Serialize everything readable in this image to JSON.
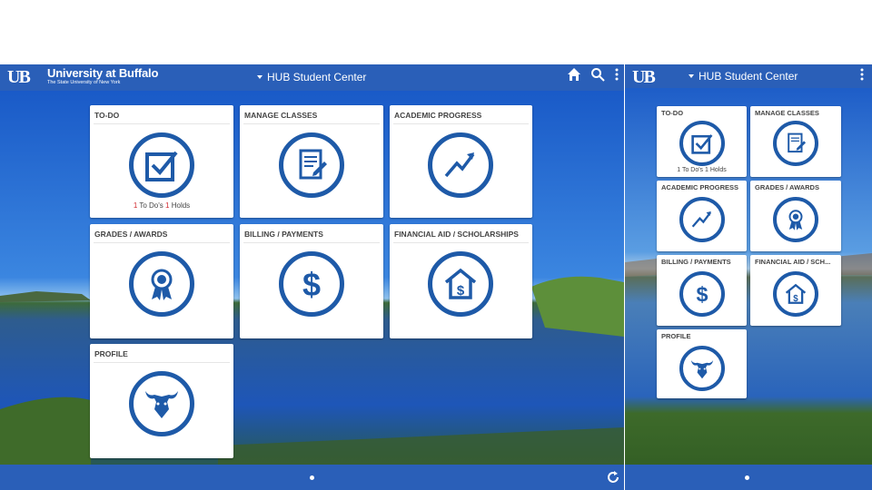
{
  "tablet": {
    "brand": {
      "name": "University at Buffalo",
      "subtitle": "The State University of New York",
      "logo_letters": "UB"
    },
    "title": "HUB Student Center",
    "top_icons": [
      "home-icon",
      "search-icon",
      "more-vert-icon"
    ],
    "tiles": [
      {
        "key": "todo",
        "title": "TO-DO",
        "icon": "checkbox-icon",
        "status": {
          "todo_count": "1",
          "todo_label": "To Do's",
          "holds_count": "1",
          "holds_label": "Holds"
        }
      },
      {
        "key": "manage",
        "title": "MANAGE CLASSES",
        "icon": "document-pencil-icon"
      },
      {
        "key": "progress",
        "title": "ACADEMIC PROGRESS",
        "icon": "trend-arrow-icon"
      },
      {
        "key": "grades",
        "title": "GRADES / AWARDS",
        "icon": "award-ribbon-icon"
      },
      {
        "key": "billing",
        "title": "BILLING / PAYMENTS",
        "icon": "dollar-icon"
      },
      {
        "key": "finaid",
        "title": "FINANCIAL AID / SCHOLARSHIPS",
        "icon": "house-dollar-icon"
      },
      {
        "key": "profile",
        "title": "PROFILE",
        "icon": "bull-icon"
      }
    ],
    "bottom_icons": [
      "page-dot-icon",
      "refresh-icon"
    ]
  },
  "phone": {
    "brand": {
      "logo_letters": "UB"
    },
    "title": "HUB Student Center",
    "top_icons": [
      "more-vert-icon"
    ],
    "tiles": [
      {
        "key": "todo",
        "title": "TO-DO",
        "icon": "checkbox-icon",
        "status": {
          "todo_count": "1",
          "todo_label": "To Do's",
          "holds_count": "1",
          "holds_label": "Holds"
        }
      },
      {
        "key": "manage",
        "title": "MANAGE CLASSES",
        "icon": "document-pencil-icon"
      },
      {
        "key": "progress",
        "title": "ACADEMIC PROGRESS",
        "icon": "trend-arrow-icon"
      },
      {
        "key": "grades",
        "title": "GRADES / AWARDS",
        "icon": "award-ribbon-icon"
      },
      {
        "key": "billing",
        "title": "BILLING / PAYMENTS",
        "icon": "dollar-icon"
      },
      {
        "key": "finaid",
        "title": "FINANCIAL AID / SCH...",
        "icon": "house-dollar-icon"
      },
      {
        "key": "profile",
        "title": "PROFILE",
        "icon": "bull-icon"
      }
    ],
    "bottom_icons": [
      "page-dot-icon"
    ]
  },
  "colors": {
    "brand_blue": "#2a5fb8",
    "icon_blue": "#1e5aa8",
    "alert_red": "#d0262b",
    "tile_bg": "#ffffff"
  }
}
